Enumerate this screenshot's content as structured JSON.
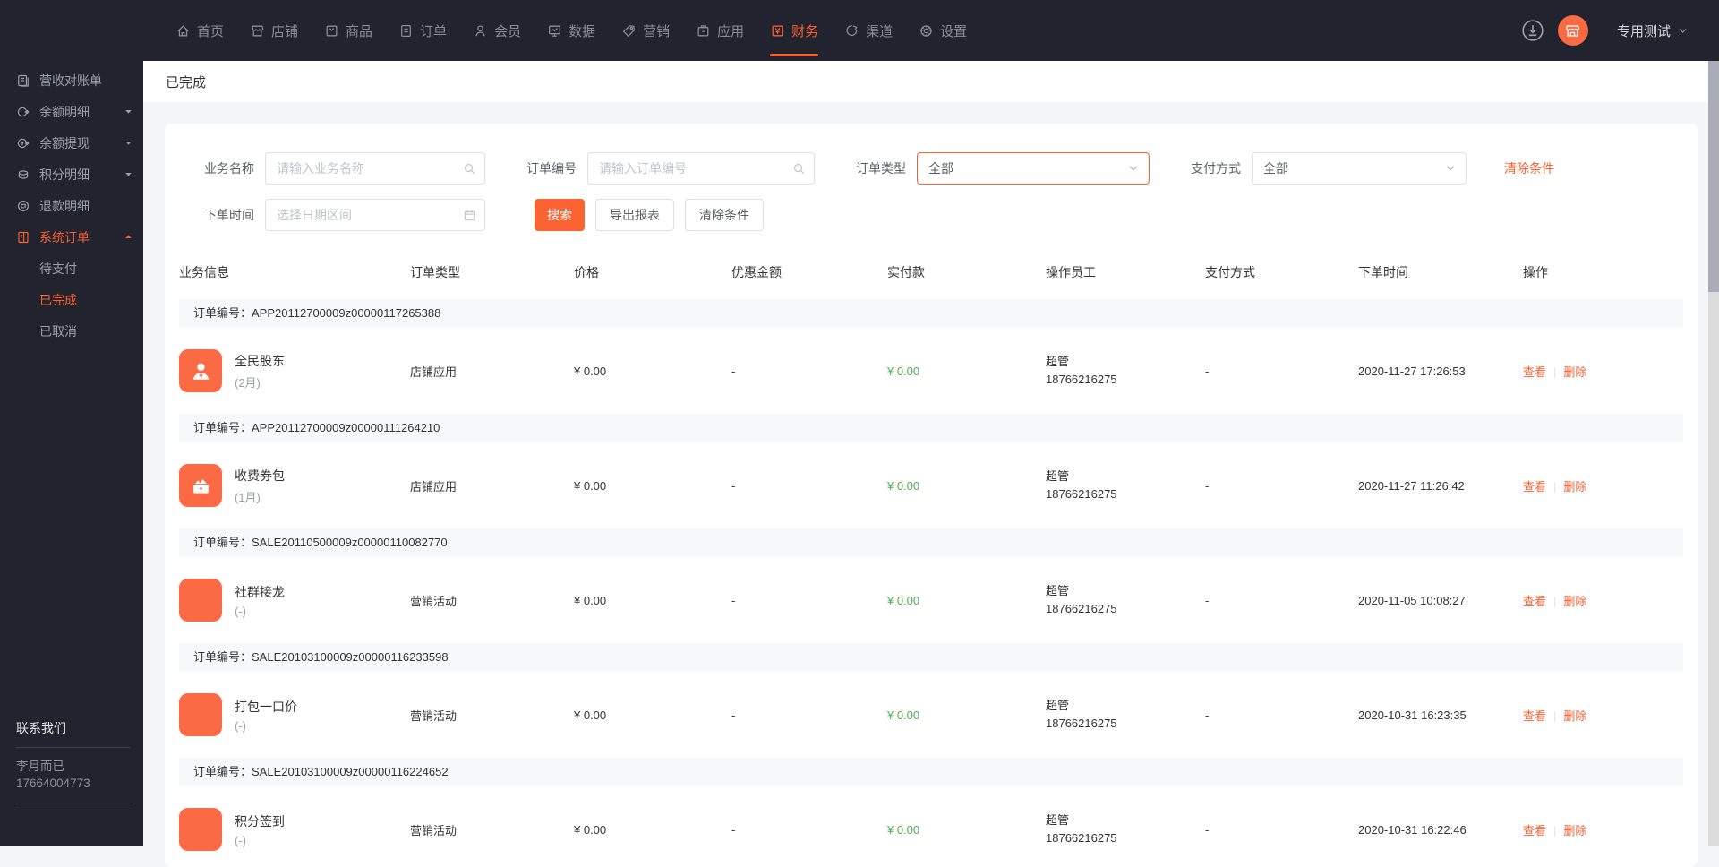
{
  "colors": {
    "accent_orange": "#FC5E2F",
    "button_orange": "#FC6333",
    "icon_orange": "#FA6A43",
    "success_green": "#4CAF50",
    "dark_bg": "#21242E"
  },
  "topnav": {
    "items": [
      {
        "label": "首页",
        "icon": "home"
      },
      {
        "label": "店铺",
        "icon": "shop"
      },
      {
        "label": "商品",
        "icon": "goods"
      },
      {
        "label": "订单",
        "icon": "order"
      },
      {
        "label": "会员",
        "icon": "member"
      },
      {
        "label": "数据",
        "icon": "data"
      },
      {
        "label": "营销",
        "icon": "marketing"
      },
      {
        "label": "应用",
        "icon": "app"
      },
      {
        "label": "财务",
        "icon": "finance"
      },
      {
        "label": "渠道",
        "icon": "channel"
      },
      {
        "label": "设置",
        "icon": "settings"
      }
    ],
    "active": "财务",
    "account_label": "专用测试"
  },
  "sidebar": {
    "items": [
      {
        "label": "营收对账单",
        "icon": "bill",
        "caret": ""
      },
      {
        "label": "余额明细",
        "icon": "balance",
        "caret": "down"
      },
      {
        "label": "余额提现",
        "icon": "withdraw",
        "caret": "down"
      },
      {
        "label": "积分明细",
        "icon": "points",
        "caret": "down"
      },
      {
        "label": "退款明细",
        "icon": "refund",
        "caret": ""
      },
      {
        "label": "系统订单",
        "icon": "sysorder",
        "caret": "up",
        "active": true,
        "children": [
          "待支付",
          "已完成",
          "已取消"
        ]
      }
    ],
    "active_child": "已完成",
    "contact": {
      "title": "联系我们",
      "name": "李月而已",
      "phone": "17664004773"
    }
  },
  "page": {
    "title": "已完成"
  },
  "filters": {
    "business_name": {
      "label": "业务名称",
      "placeholder": "请输入业务名称"
    },
    "order_no": {
      "label": "订单编号",
      "placeholder": "请输入订单编号"
    },
    "order_type": {
      "label": "订单类型",
      "value": "全部"
    },
    "pay_method": {
      "label": "支付方式",
      "value": "全部"
    },
    "clear_link": "清除条件",
    "order_time": {
      "label": "下单时间",
      "placeholder": "选择日期区间"
    },
    "buttons": {
      "search": "搜索",
      "export": "导出报表",
      "clear": "清除条件"
    }
  },
  "table": {
    "headers": [
      "业务信息",
      "订单类型",
      "价格",
      "优惠金额",
      "实付款",
      "操作员工",
      "支付方式",
      "下单时间",
      "操作"
    ],
    "order_no_prefix": "订单编号：",
    "actions": {
      "view": "查看",
      "delete": "删除"
    },
    "groups": [
      {
        "order_no": "APP20112700009z00000117265388",
        "icon": "biz-member",
        "name": "全民股东",
        "duration": "(2月)",
        "type": "店铺应用",
        "price": "¥ 0.00",
        "discount": "-",
        "paid": "¥ 0.00",
        "operator_role": "超管",
        "operator_phone": "18766216275",
        "pay_method": "-",
        "time": "2020-11-27 17:26:53"
      },
      {
        "order_no": "APP20112700009z00000111264210",
        "icon": "biz-coupon",
        "name": "收费券包",
        "duration": "(1月)",
        "type": "店铺应用",
        "price": "¥ 0.00",
        "discount": "-",
        "paid": "¥ 0.00",
        "operator_role": "超管",
        "operator_phone": "18766216275",
        "pay_method": "-",
        "time": "2020-11-27 11:26:42"
      },
      {
        "order_no": "SALE20110500009z00000110082770",
        "icon": "biz-plain",
        "name": "社群接龙",
        "duration": "(-)",
        "type": "营销活动",
        "price": "¥ 0.00",
        "discount": "-",
        "paid": "¥ 0.00",
        "operator_role": "超管",
        "operator_phone": "18766216275",
        "pay_method": "-",
        "time": "2020-11-05 10:08:27"
      },
      {
        "order_no": "SALE20103100009z00000116233598",
        "icon": "biz-plain",
        "name": "打包一口价",
        "duration": "(-)",
        "type": "营销活动",
        "price": "¥ 0.00",
        "discount": "-",
        "paid": "¥ 0.00",
        "operator_role": "超管",
        "operator_phone": "18766216275",
        "pay_method": "-",
        "time": "2020-10-31 16:23:35"
      },
      {
        "order_no": "SALE20103100009z00000116224652",
        "icon": "biz-plain",
        "name": "积分签到",
        "duration": "(-)",
        "type": "营销活动",
        "price": "¥ 0.00",
        "discount": "-",
        "paid": "¥ 0.00",
        "operator_role": "超管",
        "operator_phone": "18766216275",
        "pay_method": "-",
        "time": "2020-10-31 16:22:46"
      }
    ]
  }
}
